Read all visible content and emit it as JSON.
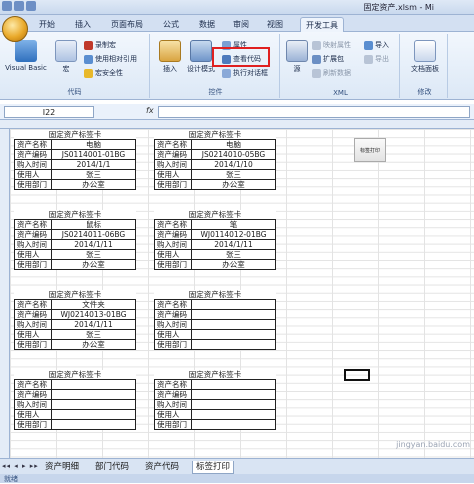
{
  "window": {
    "title": "固定资产.xlsm - Mi"
  },
  "tabs": [
    "开始",
    "插入",
    "页面布局",
    "公式",
    "数据",
    "审阅",
    "视图",
    "开发工具"
  ],
  "active_tab": "开发工具",
  "ribbon": {
    "code": {
      "label": "代码",
      "visual_basic": "Visual Basic",
      "macro": "宏",
      "record_macro": "录制宏",
      "relative_ref": "使用相对引用",
      "macro_security": "宏安全性"
    },
    "controls": {
      "label": "控件",
      "insert": "插入",
      "design_mode": "设计模式",
      "properties": "属性",
      "view_code": "查看代码",
      "run_dialog": "执行对话框"
    },
    "xml": {
      "label": "XML",
      "source": "源",
      "map_props": "映射属性",
      "expansion": "扩展包",
      "refresh": "刷新数据",
      "import": "导入",
      "export": "导出"
    },
    "modify": {
      "label": "修改",
      "doc_panel": "文档面板"
    }
  },
  "formula_bar": {
    "namebox": "I22",
    "fx": "fx",
    "content": ""
  },
  "cards": [
    {
      "title": "固定资产标签卡",
      "rows": [
        [
          "资产名称",
          "电脑"
        ],
        [
          "资产编码",
          "JS0114001-01BG"
        ],
        [
          "购入时间",
          "2014/1/1"
        ],
        [
          "使用人",
          "张三"
        ],
        [
          "使用部门",
          "办公室"
        ]
      ]
    },
    {
      "title": "固定资产标签卡",
      "rows": [
        [
          "资产名称",
          "电脑"
        ],
        [
          "资产编码",
          "JS0214010-05BG"
        ],
        [
          "购入时间",
          "2014/1/10"
        ],
        [
          "使用人",
          "张三"
        ],
        [
          "使用部门",
          "办公室"
        ]
      ]
    },
    {
      "title": "固定资产标签卡",
      "rows": [
        [
          "资产名称",
          "鼠标"
        ],
        [
          "资产编码",
          "JS0214011-06BG"
        ],
        [
          "购入时间",
          "2014/1/11"
        ],
        [
          "使用人",
          "张三"
        ],
        [
          "使用部门",
          "办公室"
        ]
      ]
    },
    {
      "title": "固定资产标签卡",
      "rows": [
        [
          "资产名称",
          "笔"
        ],
        [
          "资产编码",
          "WJ0114012-01BG"
        ],
        [
          "购入时间",
          "2014/1/11"
        ],
        [
          "使用人",
          "张三"
        ],
        [
          "使用部门",
          "办公室"
        ]
      ]
    },
    {
      "title": "固定资产标签卡",
      "rows": [
        [
          "资产名称",
          "文件夹"
        ],
        [
          "资产编码",
          "WJ0214013-01BG"
        ],
        [
          "购入时间",
          "2014/1/11"
        ],
        [
          "使用人",
          "张三"
        ],
        [
          "使用部门",
          "办公室"
        ]
      ]
    },
    {
      "title": "固定资产标签卡",
      "rows": [
        [
          "资产名称",
          ""
        ],
        [
          "资产编码",
          ""
        ],
        [
          "购入时间",
          ""
        ],
        [
          "使用人",
          ""
        ],
        [
          "使用部门",
          ""
        ]
      ]
    },
    {
      "title": "固定资产标签卡",
      "rows": [
        [
          "资产名称",
          ""
        ],
        [
          "资产编码",
          ""
        ],
        [
          "购入时间",
          ""
        ],
        [
          "使用人",
          ""
        ],
        [
          "使用部门",
          ""
        ]
      ]
    },
    {
      "title": "固定资产标签卡",
      "rows": [
        [
          "资产名称",
          ""
        ],
        [
          "资产编码",
          ""
        ],
        [
          "购入时间",
          ""
        ],
        [
          "使用人",
          ""
        ],
        [
          "使用部门",
          ""
        ]
      ]
    }
  ],
  "print_button": "标签打印",
  "sheet_tabs": [
    "资产明细",
    "部门代码",
    "资产代码",
    "标签打印"
  ],
  "active_sheet": "标签打印",
  "status": "就绪",
  "watermark": "jingyan.baidu.com"
}
